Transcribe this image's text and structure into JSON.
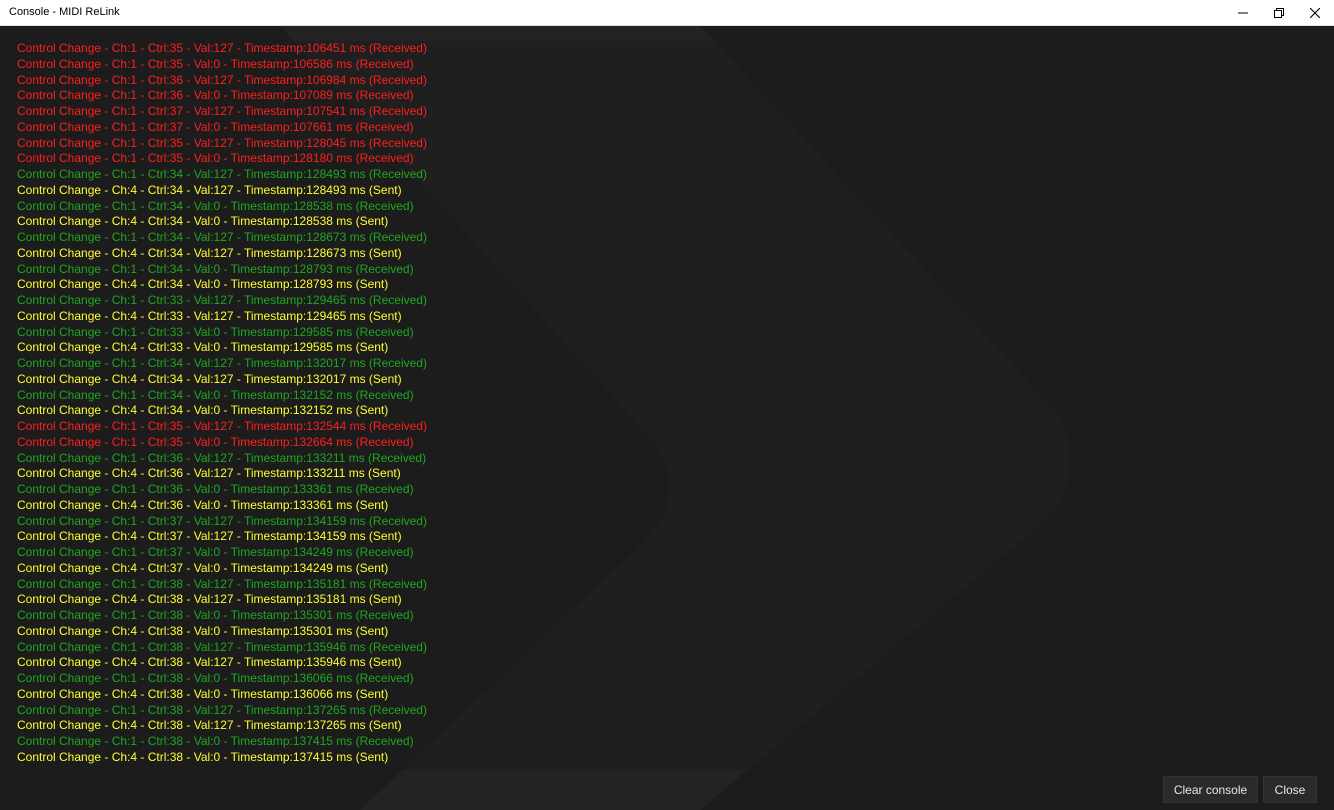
{
  "window": {
    "title": "Console - MIDI ReLink"
  },
  "colors": {
    "received_red": "#ff1f1f",
    "received_green": "#1fa81f",
    "sent": "#ffff33",
    "background": "#1c1c1c"
  },
  "log": [
    {
      "text": "Control Change - Ch:1 - Ctrl:35 - Val:127 - Timestamp:106451 ms (Received)",
      "color": "red"
    },
    {
      "text": "Control Change - Ch:1 - Ctrl:35 - Val:0 - Timestamp:106586 ms (Received)",
      "color": "red"
    },
    {
      "text": "Control Change - Ch:1 - Ctrl:36 - Val:127 - Timestamp:106984 ms (Received)",
      "color": "red"
    },
    {
      "text": "Control Change - Ch:1 - Ctrl:36 - Val:0 - Timestamp:107089 ms (Received)",
      "color": "red"
    },
    {
      "text": "Control Change - Ch:1 - Ctrl:37 - Val:127 - Timestamp:107541 ms (Received)",
      "color": "red"
    },
    {
      "text": "Control Change - Ch:1 - Ctrl:37 - Val:0 - Timestamp:107661 ms (Received)",
      "color": "red"
    },
    {
      "text": "Control Change - Ch:1 - Ctrl:35 - Val:127 - Timestamp:128045 ms (Received)",
      "color": "red"
    },
    {
      "text": "Control Change - Ch:1 - Ctrl:35 - Val:0 - Timestamp:128180 ms (Received)",
      "color": "red"
    },
    {
      "text": "Control Change - Ch:1 - Ctrl:34 - Val:127 - Timestamp:128493 ms (Received)",
      "color": "green"
    },
    {
      "text": "Control Change - Ch:4 - Ctrl:34 - Val:127 - Timestamp:128493 ms (Sent)",
      "color": "yellow"
    },
    {
      "text": "Control Change - Ch:1 - Ctrl:34 - Val:0 - Timestamp:128538 ms (Received)",
      "color": "green"
    },
    {
      "text": "Control Change - Ch:4 - Ctrl:34 - Val:0 - Timestamp:128538 ms (Sent)",
      "color": "yellow"
    },
    {
      "text": "Control Change - Ch:1 - Ctrl:34 - Val:127 - Timestamp:128673 ms (Received)",
      "color": "green"
    },
    {
      "text": "Control Change - Ch:4 - Ctrl:34 - Val:127 - Timestamp:128673 ms (Sent)",
      "color": "yellow"
    },
    {
      "text": "Control Change - Ch:1 - Ctrl:34 - Val:0 - Timestamp:128793 ms (Received)",
      "color": "green"
    },
    {
      "text": "Control Change - Ch:4 - Ctrl:34 - Val:0 - Timestamp:128793 ms (Sent)",
      "color": "yellow"
    },
    {
      "text": "Control Change - Ch:1 - Ctrl:33 - Val:127 - Timestamp:129465 ms (Received)",
      "color": "green"
    },
    {
      "text": "Control Change - Ch:4 - Ctrl:33 - Val:127 - Timestamp:129465 ms (Sent)",
      "color": "yellow"
    },
    {
      "text": "Control Change - Ch:1 - Ctrl:33 - Val:0 - Timestamp:129585 ms (Received)",
      "color": "green"
    },
    {
      "text": "Control Change - Ch:4 - Ctrl:33 - Val:0 - Timestamp:129585 ms (Sent)",
      "color": "yellow"
    },
    {
      "text": "Control Change - Ch:1 - Ctrl:34 - Val:127 - Timestamp:132017 ms (Received)",
      "color": "green"
    },
    {
      "text": "Control Change - Ch:4 - Ctrl:34 - Val:127 - Timestamp:132017 ms (Sent)",
      "color": "yellow"
    },
    {
      "text": "Control Change - Ch:1 - Ctrl:34 - Val:0 - Timestamp:132152 ms (Received)",
      "color": "green"
    },
    {
      "text": "Control Change - Ch:4 - Ctrl:34 - Val:0 - Timestamp:132152 ms (Sent)",
      "color": "yellow"
    },
    {
      "text": "Control Change - Ch:1 - Ctrl:35 - Val:127 - Timestamp:132544 ms (Received)",
      "color": "red"
    },
    {
      "text": "Control Change - Ch:1 - Ctrl:35 - Val:0 - Timestamp:132664 ms (Received)",
      "color": "red"
    },
    {
      "text": "Control Change - Ch:1 - Ctrl:36 - Val:127 - Timestamp:133211 ms (Received)",
      "color": "green"
    },
    {
      "text": "Control Change - Ch:4 - Ctrl:36 - Val:127 - Timestamp:133211 ms (Sent)",
      "color": "yellow"
    },
    {
      "text": "Control Change - Ch:1 - Ctrl:36 - Val:0 - Timestamp:133361 ms (Received)",
      "color": "green"
    },
    {
      "text": "Control Change - Ch:4 - Ctrl:36 - Val:0 - Timestamp:133361 ms (Sent)",
      "color": "yellow"
    },
    {
      "text": "Control Change - Ch:1 - Ctrl:37 - Val:127 - Timestamp:134159 ms (Received)",
      "color": "green"
    },
    {
      "text": "Control Change - Ch:4 - Ctrl:37 - Val:127 - Timestamp:134159 ms (Sent)",
      "color": "yellow"
    },
    {
      "text": "Control Change - Ch:1 - Ctrl:37 - Val:0 - Timestamp:134249 ms (Received)",
      "color": "green"
    },
    {
      "text": "Control Change - Ch:4 - Ctrl:37 - Val:0 - Timestamp:134249 ms (Sent)",
      "color": "yellow"
    },
    {
      "text": "Control Change - Ch:1 - Ctrl:38 - Val:127 - Timestamp:135181 ms (Received)",
      "color": "green"
    },
    {
      "text": "Control Change - Ch:4 - Ctrl:38 - Val:127 - Timestamp:135181 ms (Sent)",
      "color": "yellow"
    },
    {
      "text": "Control Change - Ch:1 - Ctrl:38 - Val:0 - Timestamp:135301 ms (Received)",
      "color": "green"
    },
    {
      "text": "Control Change - Ch:4 - Ctrl:38 - Val:0 - Timestamp:135301 ms (Sent)",
      "color": "yellow"
    },
    {
      "text": "Control Change - Ch:1 - Ctrl:38 - Val:127 - Timestamp:135946 ms (Received)",
      "color": "green"
    },
    {
      "text": "Control Change - Ch:4 - Ctrl:38 - Val:127 - Timestamp:135946 ms (Sent)",
      "color": "yellow"
    },
    {
      "text": "Control Change - Ch:1 - Ctrl:38 - Val:0 - Timestamp:136066 ms (Received)",
      "color": "green"
    },
    {
      "text": "Control Change - Ch:4 - Ctrl:38 - Val:0 - Timestamp:136066 ms (Sent)",
      "color": "yellow"
    },
    {
      "text": "Control Change - Ch:1 - Ctrl:38 - Val:127 - Timestamp:137265 ms (Received)",
      "color": "green"
    },
    {
      "text": "Control Change - Ch:4 - Ctrl:38 - Val:127 - Timestamp:137265 ms (Sent)",
      "color": "yellow"
    },
    {
      "text": "Control Change - Ch:1 - Ctrl:38 - Val:0 - Timestamp:137415 ms (Received)",
      "color": "green"
    },
    {
      "text": "Control Change - Ch:4 - Ctrl:38 - Val:0 - Timestamp:137415 ms (Sent)",
      "color": "yellow"
    }
  ],
  "buttons": {
    "clear_label": "Clear console",
    "close_label": "Close"
  }
}
